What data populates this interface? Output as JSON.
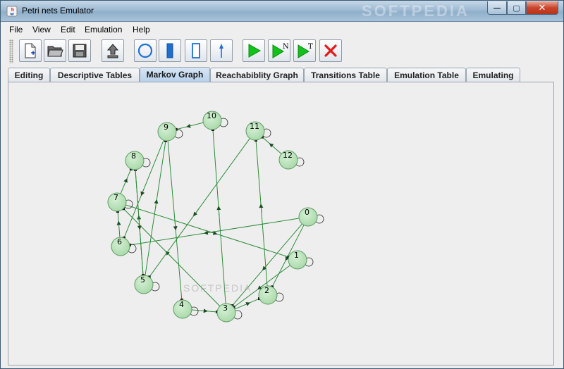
{
  "window": {
    "title": "Petri nets Emulator",
    "watermark": "SOFTPEDIA",
    "minimize_label": "—",
    "maximize_label": "▢",
    "close_label": "✕"
  },
  "menu": [
    "File",
    "View",
    "Edit",
    "Emulation",
    "Help"
  ],
  "toolbar": {
    "buttons": [
      {
        "name": "new-file-icon"
      },
      {
        "name": "open-folder-icon"
      },
      {
        "name": "save-disk-icon"
      },
      {
        "name": "export-upload-icon"
      },
      {
        "name": "place-circle-icon"
      },
      {
        "name": "transition-filled-icon"
      },
      {
        "name": "transition-empty-icon"
      },
      {
        "name": "arc-arrow-icon"
      },
      {
        "name": "play-icon"
      },
      {
        "name": "play-n-icon",
        "letter": "N"
      },
      {
        "name": "play-t-icon",
        "letter": "T"
      },
      {
        "name": "stop-x-icon"
      }
    ]
  },
  "tabs": [
    {
      "label": "Editing"
    },
    {
      "label": "Descriptive Tables"
    },
    {
      "label": "Markov Graph",
      "active": true
    },
    {
      "label": "Reachabiblity Graph"
    },
    {
      "label": "Transitions Table"
    },
    {
      "label": "Emulation Table"
    },
    {
      "label": "Emulating"
    }
  ],
  "graph": {
    "node_color": "#a8d8a8",
    "edge_color": "#2e8b3a",
    "nodes": [
      {
        "id": "0"
      },
      {
        "id": "1"
      },
      {
        "id": "2"
      },
      {
        "id": "3"
      },
      {
        "id": "4"
      },
      {
        "id": "5"
      },
      {
        "id": "6"
      },
      {
        "id": "7"
      },
      {
        "id": "8"
      },
      {
        "id": "9"
      },
      {
        "id": "10"
      },
      {
        "id": "11"
      },
      {
        "id": "12"
      }
    ],
    "edges": [
      [
        "0",
        "2"
      ],
      [
        "0",
        "3"
      ],
      [
        "0",
        "6"
      ],
      [
        "1",
        "3"
      ],
      [
        "2",
        "11"
      ],
      [
        "3",
        "7"
      ],
      [
        "3",
        "10"
      ],
      [
        "3",
        "2"
      ],
      [
        "4",
        "3"
      ],
      [
        "5",
        "8"
      ],
      [
        "5",
        "9"
      ],
      [
        "6",
        "7"
      ],
      [
        "7",
        "8"
      ],
      [
        "7",
        "1"
      ],
      [
        "8",
        "5"
      ],
      [
        "9",
        "4"
      ],
      [
        "9",
        "6"
      ],
      [
        "10",
        "9"
      ],
      [
        "11",
        "5"
      ],
      [
        "12",
        "11"
      ]
    ]
  },
  "canvas_watermark": "SOFTPEDIA"
}
